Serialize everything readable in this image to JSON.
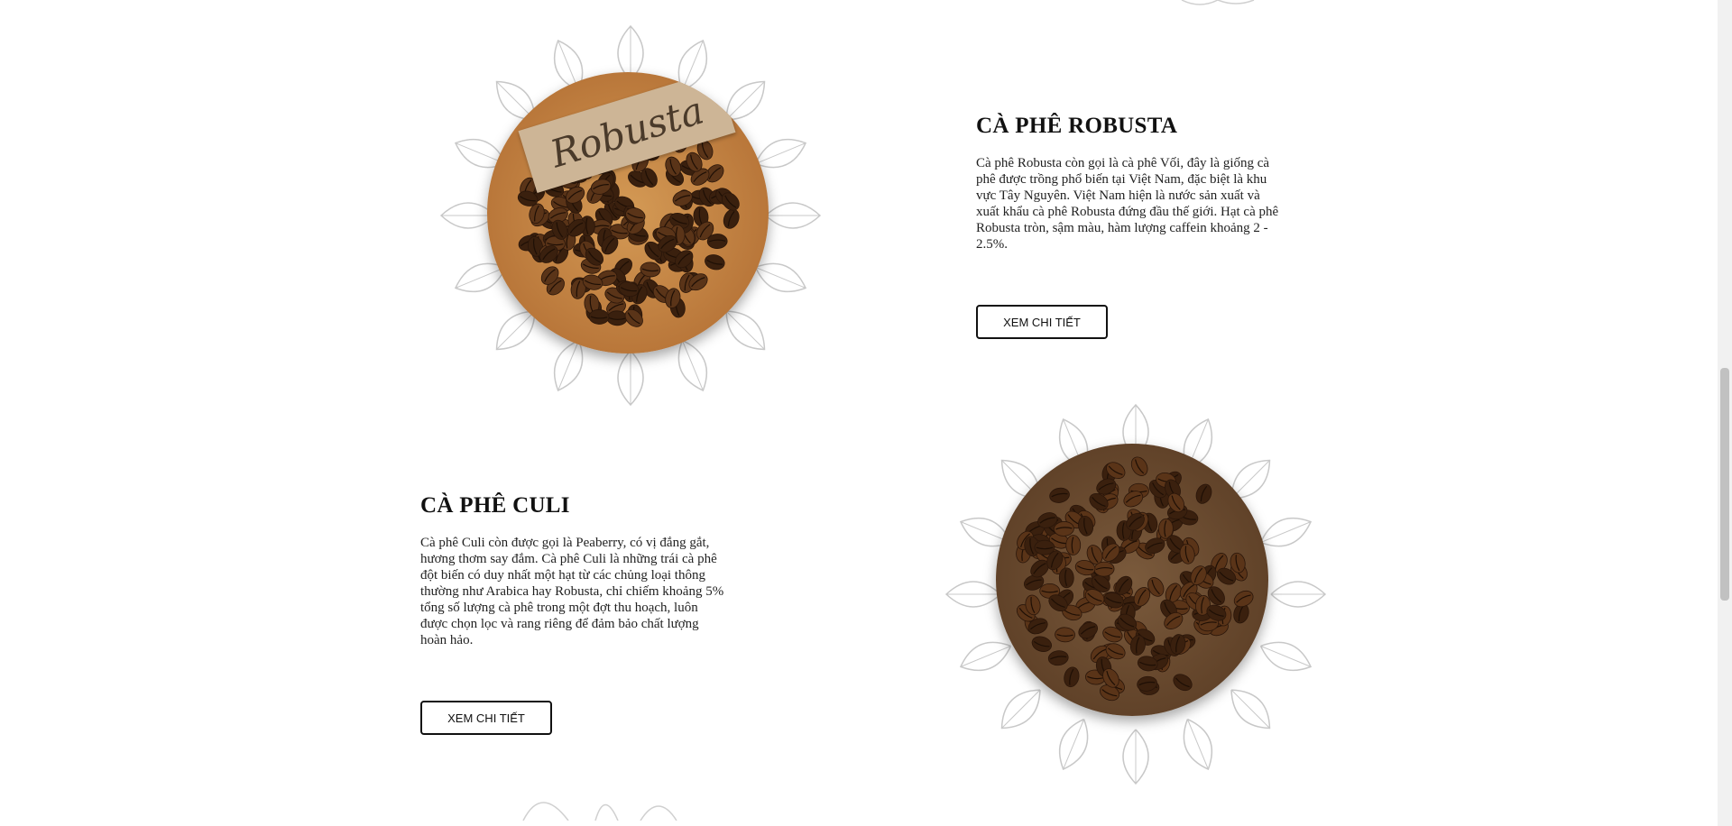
{
  "products": [
    {
      "title": "CÀ PHÊ ROBUSTA",
      "description": "Cà phê Robusta còn gọi là cà phê Vối, đây là giống cà phê được trồng phổ biến tại Việt Nam, đặc biệt là khu vực Tây Nguyên. Việt Nam hiện là nước sản xuất và xuất khẩu cà phê Robusta đứng đầu thế giới. Hạt cà phê Robusta tròn, sậm màu, hàm lượng caffein khoảng 2 - 2.5%.",
      "button_label": "XEM CHI TIẾT",
      "image_tag_text": "Robusta"
    },
    {
      "title": "CÀ PHÊ CULI",
      "description": "Cà phê Culi còn được gọi là Peaberry, có vị đắng gắt, hương thơm say đắm. Cà phê Culi là những trái cà phê đột biến có duy nhất một hạt từ các chủng loại thông thường như Arabica hay Robusta, chỉ chiếm khoảng 5% tổng số lượng cà phê trong một đợt thu hoạch, luôn được chọn lọc và rang riêng để đảm bảo chất lượng hoàn hảo.",
      "button_label": "XEM CHI TIẾT"
    }
  ],
  "colors": {
    "bean": "#5a3418",
    "bean_dark": "#3a200e",
    "bowl_wood": "#c98a45",
    "leaf_stroke": "#c8c8c8"
  }
}
